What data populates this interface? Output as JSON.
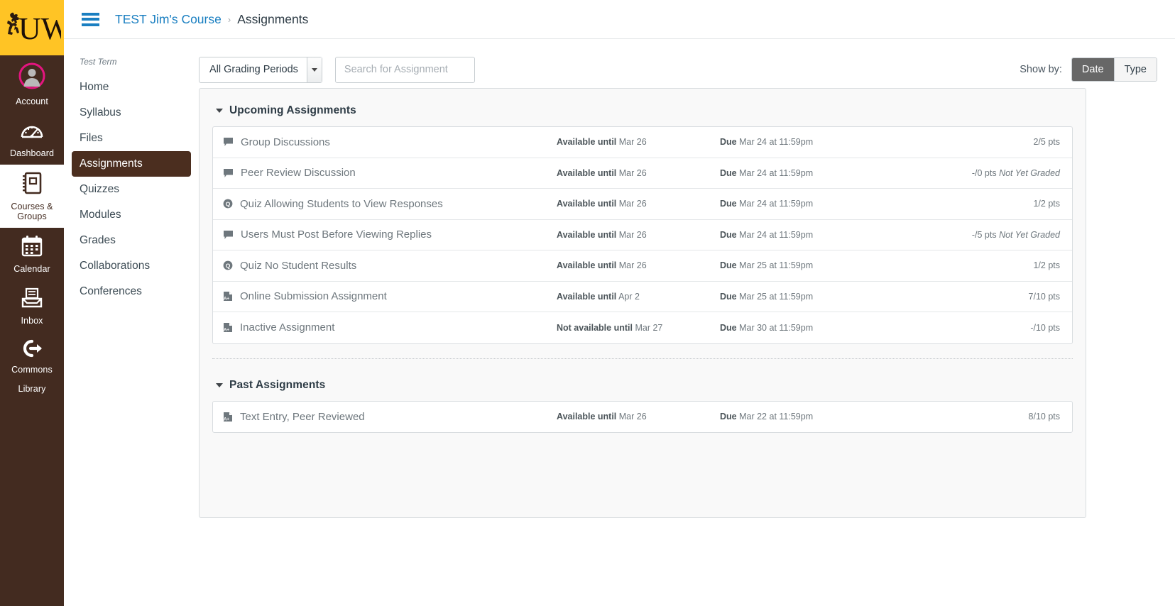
{
  "global_nav": {
    "brand": {
      "icon": "uw-cowboy-logo",
      "text": "UW"
    },
    "items": [
      {
        "label": "Account",
        "icon": "account-avatar-icon",
        "active": false
      },
      {
        "label": "Dashboard",
        "icon": "dashboard-gauge-icon",
        "active": false
      },
      {
        "label": "Courses & Groups",
        "icon": "courses-book-icon",
        "active": true
      },
      {
        "label": "Calendar",
        "icon": "calendar-icon",
        "active": false
      },
      {
        "label": "Inbox",
        "icon": "inbox-tray-icon",
        "active": false
      },
      {
        "label": "Commons",
        "icon": "commons-arrow-icon",
        "active": false
      },
      {
        "label": "Library",
        "icon": "",
        "active": false
      }
    ]
  },
  "topbar": {
    "menu_icon": "hamburger-icon",
    "breadcrumb": {
      "course": "TEST Jim's Course",
      "separator": "›",
      "current": "Assignments"
    }
  },
  "course_nav": {
    "term": "Test Term",
    "items": [
      {
        "label": "Home",
        "active": false
      },
      {
        "label": "Syllabus",
        "active": false
      },
      {
        "label": "Files",
        "active": false
      },
      {
        "label": "Assignments",
        "active": true
      },
      {
        "label": "Quizzes",
        "active": false
      },
      {
        "label": "Modules",
        "active": false
      },
      {
        "label": "Grades",
        "active": false
      },
      {
        "label": "Collaborations",
        "active": false
      },
      {
        "label": "Conferences",
        "active": false
      }
    ]
  },
  "toolbar": {
    "grading_period_value": "All Grading Periods",
    "grading_period_options": [
      "All Grading Periods"
    ],
    "search_placeholder": "Search for Assignment",
    "search_value": "",
    "show_by_label": "Show by:",
    "show_by_options": [
      {
        "label": "Date",
        "selected": true
      },
      {
        "label": "Type",
        "selected": false
      }
    ]
  },
  "groups": [
    {
      "title": "Upcoming Assignments",
      "expanded": true,
      "rows": [
        {
          "name": "Group Discussions",
          "icon": "discussion-icon",
          "availability_label": "Available until",
          "availability_value": "Mar 26",
          "due_label": "Due",
          "due_value": "Mar 24 at 11:59pm",
          "points": "2/5 pts",
          "grading_status": ""
        },
        {
          "name": "Peer Review Discussion",
          "icon": "discussion-icon",
          "availability_label": "Available until",
          "availability_value": "Mar 26",
          "due_label": "Due",
          "due_value": "Mar 24 at 11:59pm",
          "points": "-/0 pts",
          "grading_status": "Not Yet Graded"
        },
        {
          "name": "Quiz Allowing Students to View Responses",
          "icon": "quiz-icon",
          "availability_label": "Available until",
          "availability_value": "Mar 26",
          "due_label": "Due",
          "due_value": "Mar 24 at 11:59pm",
          "points": "1/2 pts",
          "grading_status": ""
        },
        {
          "name": "Users Must Post Before Viewing Replies",
          "icon": "discussion-icon",
          "availability_label": "Available until",
          "availability_value": "Mar 26",
          "due_label": "Due",
          "due_value": "Mar 24 at 11:59pm",
          "points": "-/5 pts",
          "grading_status": "Not Yet Graded"
        },
        {
          "name": "Quiz No Student Results",
          "icon": "quiz-icon",
          "availability_label": "Available until",
          "availability_value": "Mar 26",
          "due_label": "Due",
          "due_value": "Mar 25 at 11:59pm",
          "points": "1/2 pts",
          "grading_status": ""
        },
        {
          "name": "Online Submission Assignment",
          "icon": "assignment-icon",
          "availability_label": "Available until",
          "availability_value": "Apr 2",
          "due_label": "Due",
          "due_value": "Mar 25 at 11:59pm",
          "points": "7/10 pts",
          "grading_status": ""
        },
        {
          "name": "Inactive Assignment",
          "icon": "assignment-icon",
          "availability_label": "Not available until",
          "availability_value": "Mar 27",
          "due_label": "Due",
          "due_value": "Mar 30 at 11:59pm",
          "points": "-/10 pts",
          "grading_status": ""
        }
      ]
    },
    {
      "title": "Past Assignments",
      "expanded": true,
      "rows": [
        {
          "name": "Text Entry, Peer Reviewed",
          "icon": "assignment-icon",
          "availability_label": "Available until",
          "availability_value": "Mar 26",
          "due_label": "Due",
          "due_value": "Mar 22 at 11:59pm",
          "points": "8/10 pts",
          "grading_status": ""
        }
      ]
    }
  ],
  "colors": {
    "brand_gold": "#FFC425",
    "nav_brown": "#432B20",
    "active_brown": "#4b2e1f",
    "link_blue": "#1a7fc1",
    "avatar_pink": "#E4157F"
  }
}
